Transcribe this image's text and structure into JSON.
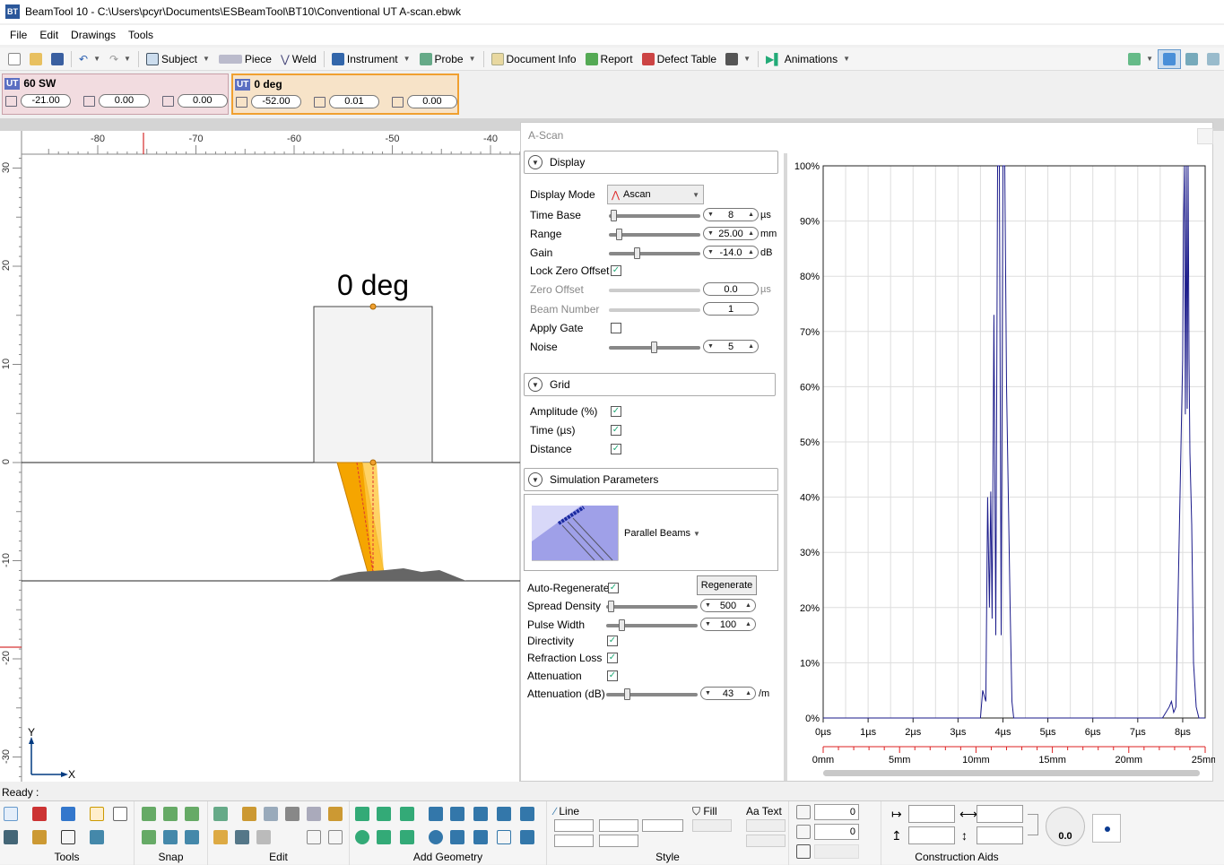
{
  "window": {
    "title": "BeamTool 10 - C:\\Users\\pcyr\\Documents\\ESBeamTool\\BT10\\Conventional UT A-scan.ebwk",
    "app_icon": "BT"
  },
  "menu": [
    "File",
    "Edit",
    "Drawings",
    "Tools"
  ],
  "toolbar": {
    "subject": "Subject",
    "piece": "Piece",
    "weld": "Weld",
    "instrument": "Instrument",
    "probe": "Probe",
    "document_info": "Document Info",
    "report": "Report",
    "defect_table": "Defect Table",
    "animations": "Animations"
  },
  "probes": [
    {
      "badge": "UT",
      "name": "60 SW",
      "v1": "-21.00",
      "v2": "0.00",
      "v3": "0.00"
    },
    {
      "badge": "UT",
      "name": "0 deg",
      "v1": "-52.00",
      "v2": "0.01",
      "v3": "0.00"
    }
  ],
  "drawing": {
    "probe_label": "0 deg",
    "x_ticks": [
      "-80",
      "-70",
      "-60",
      "-50",
      "-40"
    ],
    "y_ticks": [
      "30",
      "20",
      "10",
      "0",
      "-10",
      "-20",
      "-30"
    ],
    "axis_x": "X",
    "axis_y": "Y"
  },
  "panel": {
    "title": "A-Scan",
    "display": {
      "header": "Display",
      "display_mode_label": "Display Mode",
      "display_mode_value": "Ascan",
      "time_base_label": "Time Base",
      "time_base_value": "8",
      "time_base_unit": "µs",
      "range_label": "Range",
      "range_value": "25.00",
      "range_unit": "mm",
      "gain_label": "Gain",
      "gain_value": "-14.0",
      "gain_unit": "dB",
      "lock_zero_label": "Lock Zero Offset",
      "zero_offset_label": "Zero Offset",
      "zero_offset_value": "0.0",
      "zero_offset_unit": "µs",
      "beam_number_label": "Beam Number",
      "beam_number_value": "1",
      "apply_gate_label": "Apply Gate",
      "noise_label": "Noise",
      "noise_value": "5"
    },
    "grid": {
      "header": "Grid",
      "amplitude_label": "Amplitude (%)",
      "time_label": "Time (µs)",
      "distance_label": "Distance"
    },
    "sim": {
      "header": "Simulation Parameters",
      "beam_mode": "Parallel Beams",
      "auto_regen_label": "Auto-Regenerate",
      "regenerate_button": "Regenerate",
      "spread_density_label": "Spread Density",
      "spread_density_value": "500",
      "pulse_width_label": "Pulse Width",
      "pulse_width_value": "100",
      "directivity_label": "Directivity",
      "refraction_label": "Refraction Loss",
      "attenuation_label": "Attenuation",
      "attenuation_db_label": "Attenuation (dB)",
      "attenuation_db_value": "43",
      "attenuation_db_unit": "/m"
    },
    "checks": {
      "lock_zero": true,
      "apply_gate": false,
      "amplitude": true,
      "time": true,
      "distance": true,
      "auto_regen": true,
      "directivity": true,
      "refraction": true,
      "attenuation": true
    }
  },
  "chart_data": {
    "type": "line",
    "y_ticks": [
      "100%",
      "90%",
      "80%",
      "70%",
      "60%",
      "50%",
      "40%",
      "30%",
      "20%",
      "10%",
      "0%"
    ],
    "x_ticks": [
      "0µs",
      "1µs",
      "2µs",
      "3µs",
      "4µs",
      "5µs",
      "6µs",
      "7µs",
      "8µs"
    ],
    "dist_ticks": [
      "0mm",
      "5mm",
      "10mm",
      "15mm",
      "20mm",
      "25mm"
    ],
    "xlim": [
      0,
      8.5
    ],
    "ylim": [
      0,
      100
    ],
    "series": [
      {
        "x": [
          0,
          3.5,
          3.55,
          3.62,
          3.66,
          3.7,
          3.73,
          3.76,
          3.8,
          3.84,
          3.88,
          3.9,
          3.92,
          3.96,
          4.0,
          4.02,
          4.04,
          4.08,
          4.12,
          4.16,
          4.2,
          4.24,
          4.28,
          4.32,
          4.36,
          4.45,
          7.55,
          7.7,
          7.75,
          7.8,
          7.85,
          8.0,
          8.02,
          8.04,
          8.06,
          8.08,
          8.1,
          8.12,
          8.14,
          8.16,
          8.2,
          8.24,
          8.3,
          8.36,
          8.5
        ],
        "y": [
          0,
          0,
          5,
          3,
          40,
          20,
          41,
          18,
          73,
          15,
          100,
          100,
          100,
          15,
          100,
          100,
          100,
          60,
          40,
          20,
          3,
          0,
          0,
          0,
          0,
          0,
          0,
          2,
          3,
          1,
          2,
          65,
          90,
          100,
          55,
          100,
          56,
          100,
          65,
          48,
          35,
          10,
          2,
          0,
          0
        ]
      }
    ]
  }
}
